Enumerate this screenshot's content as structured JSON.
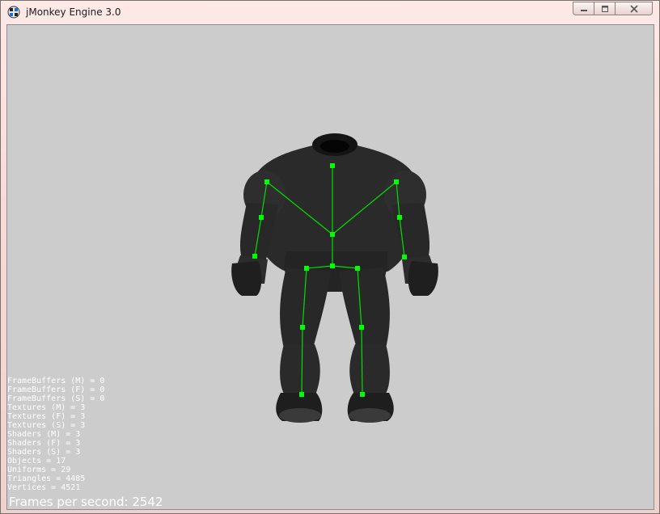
{
  "window": {
    "title": "jMonkey Engine 3.0",
    "controls": [
      "minimize",
      "maximize",
      "close"
    ]
  },
  "stats": [
    "FrameBuffers (M) = 0",
    "FrameBuffers (F) = 0",
    "FrameBuffers (S) = 0",
    "Textures (M) = 3",
    "Textures (F) = 3",
    "Textures (S) = 3",
    "Shaders (M) = 3",
    "Shaders (F) = 3",
    "Shaders (S) = 3",
    "Objects = 17",
    "Uniforms = 29",
    "Triangles = 4485",
    "Vertices = 4521"
  ],
  "fps": "Frames per second: 2542",
  "colors": {
    "viewport_bg": "#cccccc",
    "skeleton": "#00ff00",
    "model": "#2b2b2b"
  }
}
